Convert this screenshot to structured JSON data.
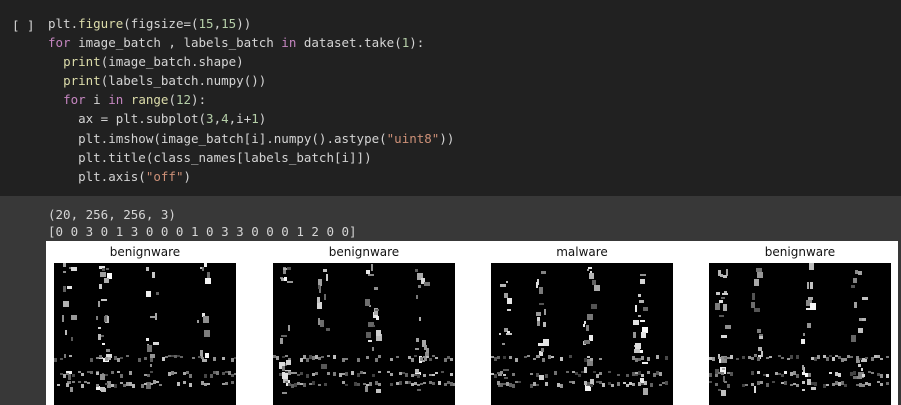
{
  "cell": {
    "run_indicator": "[ ]",
    "code_lines": [
      [
        [
          "pl",
          "plt."
        ],
        [
          "fn",
          "figure"
        ],
        [
          "pl",
          "(figsize=("
        ],
        [
          "num",
          "15"
        ],
        [
          "pl",
          ","
        ],
        [
          "num",
          "15"
        ],
        [
          "pl",
          "))"
        ]
      ],
      [
        [
          "kw",
          "for"
        ],
        [
          "pl",
          " image_batch , labels_batch "
        ],
        [
          "kw",
          "in"
        ],
        [
          "pl",
          " dataset.take("
        ],
        [
          "num",
          "1"
        ],
        [
          "pl",
          "):"
        ]
      ],
      [
        [
          "pl",
          "  "
        ],
        [
          "fn",
          "print"
        ],
        [
          "pl",
          "(image_batch.shape)"
        ]
      ],
      [
        [
          "pl",
          "  "
        ],
        [
          "fn",
          "print"
        ],
        [
          "pl",
          "(labels_batch.numpy())"
        ]
      ],
      [
        [
          "pl",
          "  "
        ],
        [
          "kw",
          "for"
        ],
        [
          "pl",
          " i "
        ],
        [
          "kw",
          "in"
        ],
        [
          "pl",
          " "
        ],
        [
          "fn",
          "range"
        ],
        [
          "pl",
          "("
        ],
        [
          "num",
          "12"
        ],
        [
          "pl",
          "):"
        ]
      ],
      [
        [
          "pl",
          "    ax = plt.subplot("
        ],
        [
          "num",
          "3"
        ],
        [
          "pl",
          ","
        ],
        [
          "num",
          "4"
        ],
        [
          "pl",
          ",i+"
        ],
        [
          "num",
          "1"
        ],
        [
          "pl",
          ")"
        ]
      ],
      [
        [
          "pl",
          "    plt.imshow(image_batch[i].numpy().astype("
        ],
        [
          "str",
          "\"uint8\""
        ],
        [
          "pl",
          "))"
        ]
      ],
      [
        [
          "pl",
          "    plt.title(class_names[labels_batch[i]])"
        ]
      ],
      [
        [
          "pl",
          "    plt.axis("
        ],
        [
          "str",
          "\"off\""
        ],
        [
          "pl",
          ")"
        ]
      ]
    ]
  },
  "output": {
    "shape_line": "(20, 256, 256, 3)",
    "labels_line": "[0 0 3 0 1 3 0 0 0 1 0 3 3 0 0 0 1 2 0 0]",
    "subplots": [
      {
        "title": "benignware"
      },
      {
        "title": "benignware"
      },
      {
        "title": "malware"
      },
      {
        "title": "benignware"
      }
    ]
  },
  "colors": {
    "editor_bg": "#212121",
    "output_bg": "#383838",
    "keyword": "#c586c0",
    "function": "#dcdcaa",
    "number": "#b5cea8",
    "string": "#ce9178"
  }
}
